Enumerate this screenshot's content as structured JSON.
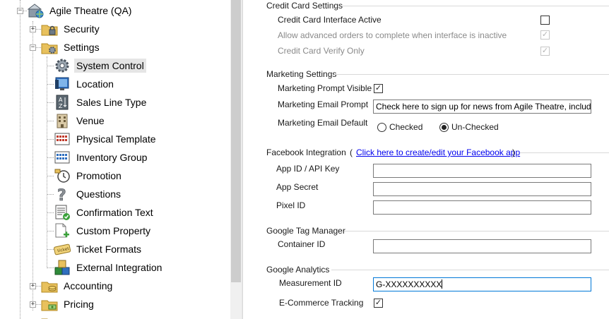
{
  "tree": {
    "root": {
      "label": "Agile Theatre (QA)",
      "icon": "theatre-globe-icon"
    },
    "items": [
      {
        "label": "Security",
        "icon": "folder-lock-icon",
        "expander": "+"
      },
      {
        "label": "Settings",
        "icon": "folder-gear-icon",
        "expander": "−"
      },
      {
        "label": "System Control",
        "icon": "gear-icon"
      },
      {
        "label": "Location",
        "icon": "location-monitor-icon"
      },
      {
        "label": "Sales Line Type",
        "icon": "sort-az-icon"
      },
      {
        "label": "Venue",
        "icon": "building-icon"
      },
      {
        "label": "Physical Template",
        "icon": "seat-grid-icon"
      },
      {
        "label": "Inventory Group",
        "icon": "seat-grid-blue-icon"
      },
      {
        "label": "Promotion",
        "icon": "clock-tag-icon"
      },
      {
        "label": "Questions",
        "icon": "question-mark-icon"
      },
      {
        "label": "Confirmation Text",
        "icon": "document-check-icon"
      },
      {
        "label": "Custom Property",
        "icon": "document-add-icon"
      },
      {
        "label": "Ticket Formats",
        "icon": "ticket-icon"
      },
      {
        "label": "External Integration",
        "icon": "cubes-icon"
      },
      {
        "label": "Accounting",
        "icon": "folder-coins-icon",
        "expander": "+"
      },
      {
        "label": "Pricing",
        "icon": "folder-money-icon",
        "expander": "+"
      }
    ]
  },
  "settings": {
    "credit_card": {
      "title": "Credit Card Settings",
      "interface_active_label": "Credit Card Interface Active",
      "interface_active_checked": false,
      "advanced_orders_label": "Allow advanced orders to complete when interface is inactive",
      "advanced_orders_checked": true,
      "verify_only_label": "Credit Card Verify Only",
      "verify_only_checked": true
    },
    "marketing": {
      "title": "Marketing Settings",
      "prompt_visible_label": "Marketing Prompt Visible",
      "prompt_visible_checked": true,
      "email_prompt_label": "Marketing Email Prompt",
      "email_prompt_value": "Check here to sign up for news from Agile Theatre, including our",
      "email_default_label": "Marketing Email Default",
      "option_checked": "Checked",
      "option_unchecked": "Un-Checked",
      "email_default_selected": "Un-Checked"
    },
    "facebook": {
      "title": "Facebook Integration",
      "paren_open": "(",
      "paren_close": ")",
      "link_text": "Click here to create/edit your Facebook app",
      "app_id_label": "App ID / API Key",
      "app_id_value": "",
      "app_secret_label": "App Secret",
      "app_secret_value": "",
      "pixel_id_label": "Pixel ID",
      "pixel_id_value": ""
    },
    "gtm": {
      "title": "Google Tag Manager",
      "container_id_label": "Container ID",
      "container_id_value": ""
    },
    "analytics": {
      "title": "Google Analytics",
      "measurement_id_label": "Measurement ID",
      "measurement_id_value": "G-XXXXXXXXXX",
      "ecommerce_label": "E-Commerce Tracking",
      "ecommerce_checked": true
    }
  }
}
